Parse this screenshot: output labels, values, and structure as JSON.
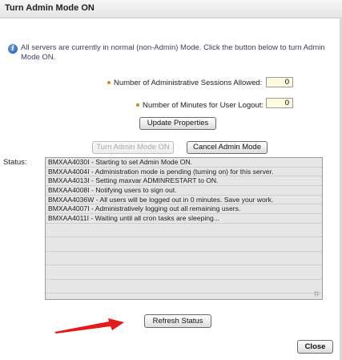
{
  "dialog": {
    "title": "Turn Admin Mode ON",
    "info_text": "All servers are currently in normal (non-Admin) Mode. Click the button below to turn Admin Mode ON."
  },
  "fields": {
    "sessions_label": "Number of Administrative Sessions Allowed:",
    "sessions_value": "0",
    "minutes_label": "Number of Minutes for User Logout:",
    "minutes_value": "0"
  },
  "buttons": {
    "update_properties": "Update Properties",
    "turn_admin_on": "Turn Admin Mode ON",
    "cancel_admin": "Cancel Admin Mode",
    "refresh_status": "Refresh Status",
    "close": "Close"
  },
  "status": {
    "label": "Status:",
    "lines": [
      "BMXAA4030I - Starting to set Admin Mode ON.",
      "BMXAA4004I - Administration mode is pending (turning on) for this server.",
      "BMXAA4013I - Setting maxvar ADMINRESTART to ON.",
      "BMXAA4008I - Notifying users to sign out.",
      "BMXAA4036W - All users will be logged out in 0 minutes. Save your work.",
      "BMXAA4007I - Administratively logging out all remaining users.",
      "BMXAA4011I - Waiting until all cron tasks are sleeping..."
    ]
  },
  "icons": {
    "info": "info-icon",
    "required": "required-dot-icon",
    "arrow": "red-arrow-icon",
    "resize": "resize-grip-icon"
  },
  "colors": {
    "arrow": "#e31b1b",
    "required_dot": "#c98a2b",
    "info_text": "#3a3f66",
    "status_bg": "#e6e6e6"
  }
}
